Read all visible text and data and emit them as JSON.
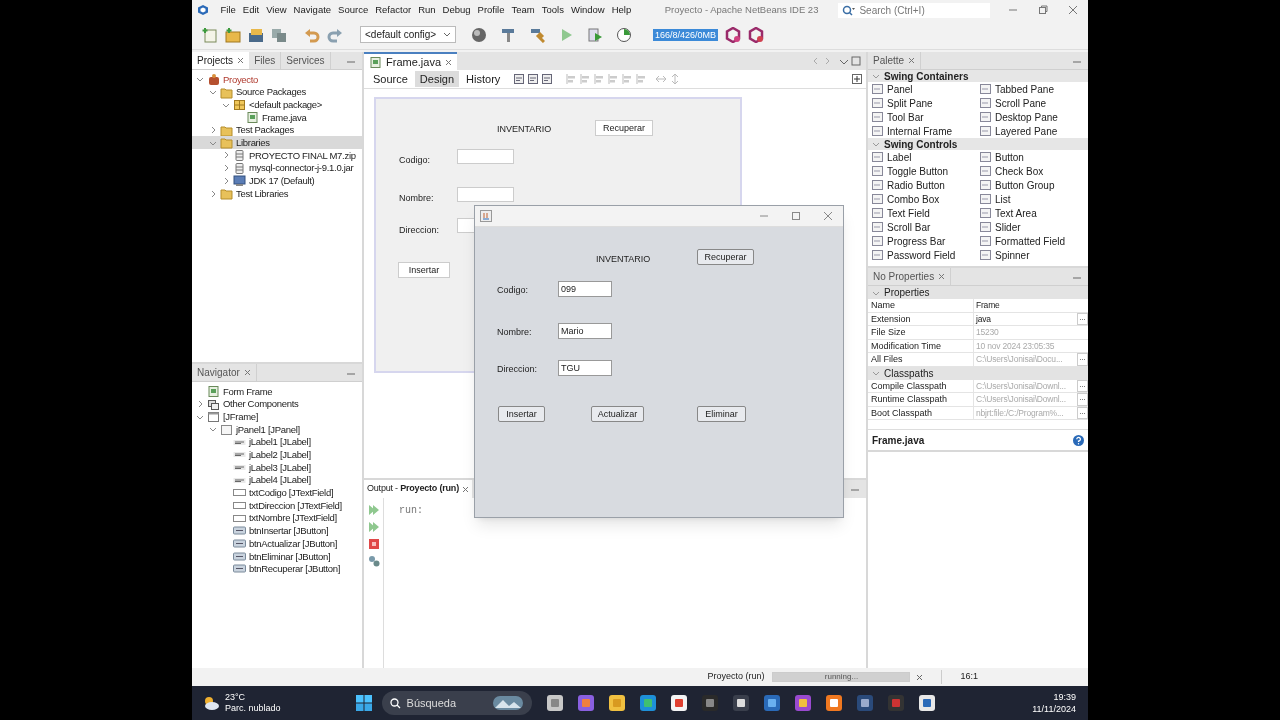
{
  "window": {
    "title": "Proyecto - Apache NetBeans IDE 23"
  },
  "menu": [
    "File",
    "Edit",
    "View",
    "Navigate",
    "Source",
    "Refactor",
    "Run",
    "Debug",
    "Profile",
    "Team",
    "Tools",
    "Window",
    "Help"
  ],
  "search": {
    "placeholder": "Search (Ctrl+I)"
  },
  "toolbar": {
    "config": "<default config>",
    "memory": "166/8/426/0MB"
  },
  "projects_panel": {
    "tabs": [
      {
        "label": "Projects",
        "selected": true
      },
      {
        "label": "Files",
        "selected": false
      },
      {
        "label": "Services",
        "selected": false
      }
    ],
    "tree": [
      {
        "label": "Proyecto",
        "kind": "project",
        "expanded": true,
        "selected": false,
        "children": [
          {
            "label": "Source Packages",
            "kind": "folder",
            "expanded": true,
            "selected": false,
            "children": [
              {
                "label": "<default package>",
                "kind": "package",
                "expanded": true,
                "selected": false,
                "children": [
                  {
                    "label": "Frame.java",
                    "kind": "form",
                    "selected": false
                  }
                ]
              }
            ]
          },
          {
            "label": "Test Packages",
            "kind": "folder",
            "expanded": false,
            "selected": false
          },
          {
            "label": "Libraries",
            "kind": "folder",
            "expanded": true,
            "selected": true,
            "children": [
              {
                "label": "PROYECTO FINAL M7.zip",
                "kind": "jar",
                "expanded": false,
                "selected": false
              },
              {
                "label": "mysql-connector-j-9.1.0.jar",
                "kind": "jar",
                "expanded": false,
                "selected": false
              },
              {
                "label": "JDK 17 (Default)",
                "kind": "jdk",
                "expanded": false,
                "selected": false
              }
            ]
          },
          {
            "label": "Test Libraries",
            "kind": "folder",
            "expanded": false,
            "selected": false
          }
        ]
      }
    ]
  },
  "navigator": {
    "title": "Navigator",
    "tree": [
      {
        "label": "Form Frame",
        "kind": "form",
        "selected": false
      },
      {
        "label": "Other Components",
        "kind": "other",
        "expanded": false,
        "selected": false
      },
      {
        "label": "[JFrame]",
        "kind": "frame",
        "expanded": true,
        "selected": false,
        "children": [
          {
            "label": "jPanel1 [JPanel]",
            "kind": "panel",
            "expanded": true,
            "selected": false,
            "children": [
              {
                "label": "jLabel1 [JLabel]",
                "kind": "label",
                "selected": false
              },
              {
                "label": "jLabel2 [JLabel]",
                "kind": "label",
                "selected": false
              },
              {
                "label": "jLabel3 [JLabel]",
                "kind": "label",
                "selected": false
              },
              {
                "label": "jLabel4 [JLabel]",
                "kind": "label",
                "selected": false
              },
              {
                "label": "txtCodigo [JTextField]",
                "kind": "textfield",
                "selected": false
              },
              {
                "label": "txtDireccion [JTextField]",
                "kind": "textfield",
                "selected": false
              },
              {
                "label": "txtNombre [JTextField]",
                "kind": "textfield",
                "selected": false
              },
              {
                "label": "btnInsertar [JButton]",
                "kind": "button",
                "selected": false
              },
              {
                "label": "btnActualizar [JButton]",
                "kind": "button",
                "selected": false
              },
              {
                "label": "btnEliminar [JButton]",
                "kind": "button",
                "selected": false
              },
              {
                "label": "btnRecuperar [JButton]",
                "kind": "button",
                "selected": false
              }
            ]
          }
        ]
      }
    ]
  },
  "editor": {
    "tab": "Frame.java",
    "views": [
      {
        "label": "Source",
        "selected": false
      },
      {
        "label": "Design",
        "selected": true
      },
      {
        "label": "History",
        "selected": false
      }
    ],
    "form": {
      "title": "INVENTARIO",
      "top_button": "Recuperar",
      "labels": [
        "Codigo:",
        "Nombre:",
        "Direccion:"
      ],
      "button": "Insertar"
    }
  },
  "output": {
    "title": "Output - **Proyecto (run)**",
    "lines": [
      "run:"
    ]
  },
  "palette": {
    "title": "Palette",
    "sections": [
      {
        "title": "Swing Containers",
        "items": [
          "Panel",
          "Tabbed Pane",
          "Split Pane",
          "Scroll Pane",
          "Tool Bar",
          "Desktop Pane",
          "Internal Frame",
          "Layered Pane"
        ]
      },
      {
        "title": "Swing Controls",
        "items": [
          "Label",
          "Button",
          "Toggle Button",
          "Check Box",
          "Radio Button",
          "Button Group",
          "Combo Box",
          "List",
          "Text Field",
          "Text Area",
          "Scroll Bar",
          "Slider",
          "Progress Bar",
          "Formatted Field",
          "Password Field",
          "Spinner"
        ]
      }
    ]
  },
  "properties": {
    "title": "No Properties",
    "sections": [
      {
        "title": "Properties",
        "rows": [
          {
            "name": "Name",
            "value": "Frame",
            "disabled": false
          },
          {
            "name": "Extension",
            "value": "java",
            "disabled": false,
            "button": "..."
          },
          {
            "name": "File Size",
            "value": "15230",
            "disabled": true
          },
          {
            "name": "Modification Time",
            "value": "10 nov 2024 23:05:35",
            "disabled": true
          },
          {
            "name": "All Files",
            "value": "C:\\Users\\Jonisai\\Docu...",
            "disabled": true,
            "button": "..."
          }
        ]
      },
      {
        "title": "Classpaths",
        "rows": [
          {
            "name": "Compile Classpath",
            "value": "C:\\Users\\Jonisai\\Downl...",
            "disabled": true,
            "button": "..."
          },
          {
            "name": "Runtime Classpath",
            "value": "C:\\Users\\Jonisai\\Downl...",
            "disabled": true,
            "button": "..."
          },
          {
            "name": "Boot Classpath",
            "value": "nbjrt:file:/C:/Program%...",
            "disabled": true,
            "button": "..."
          }
        ]
      }
    ],
    "footer": "Frame.java"
  },
  "status_bar": {
    "task": "Proyecto (run)",
    "progress_label": "running...",
    "level": 1,
    "position": "16:1"
  },
  "app_window": {
    "title": "INVENTARIO",
    "top_button": "Recuperar",
    "fields": [
      {
        "label": "Codigo:",
        "value": "099"
      },
      {
        "label": "Nombre:",
        "value": "Mario"
      },
      {
        "label": "Direccion:",
        "value": "TGU"
      }
    ],
    "buttons": [
      "Insertar",
      "Actualizar",
      "Eliminar"
    ]
  },
  "taskbar": {
    "temperature": "23°C",
    "weather": "Parc. nublado",
    "search": {
      "placeholder": "Búsqueda"
    },
    "time": "19:39",
    "date": "11/11/2024"
  }
}
